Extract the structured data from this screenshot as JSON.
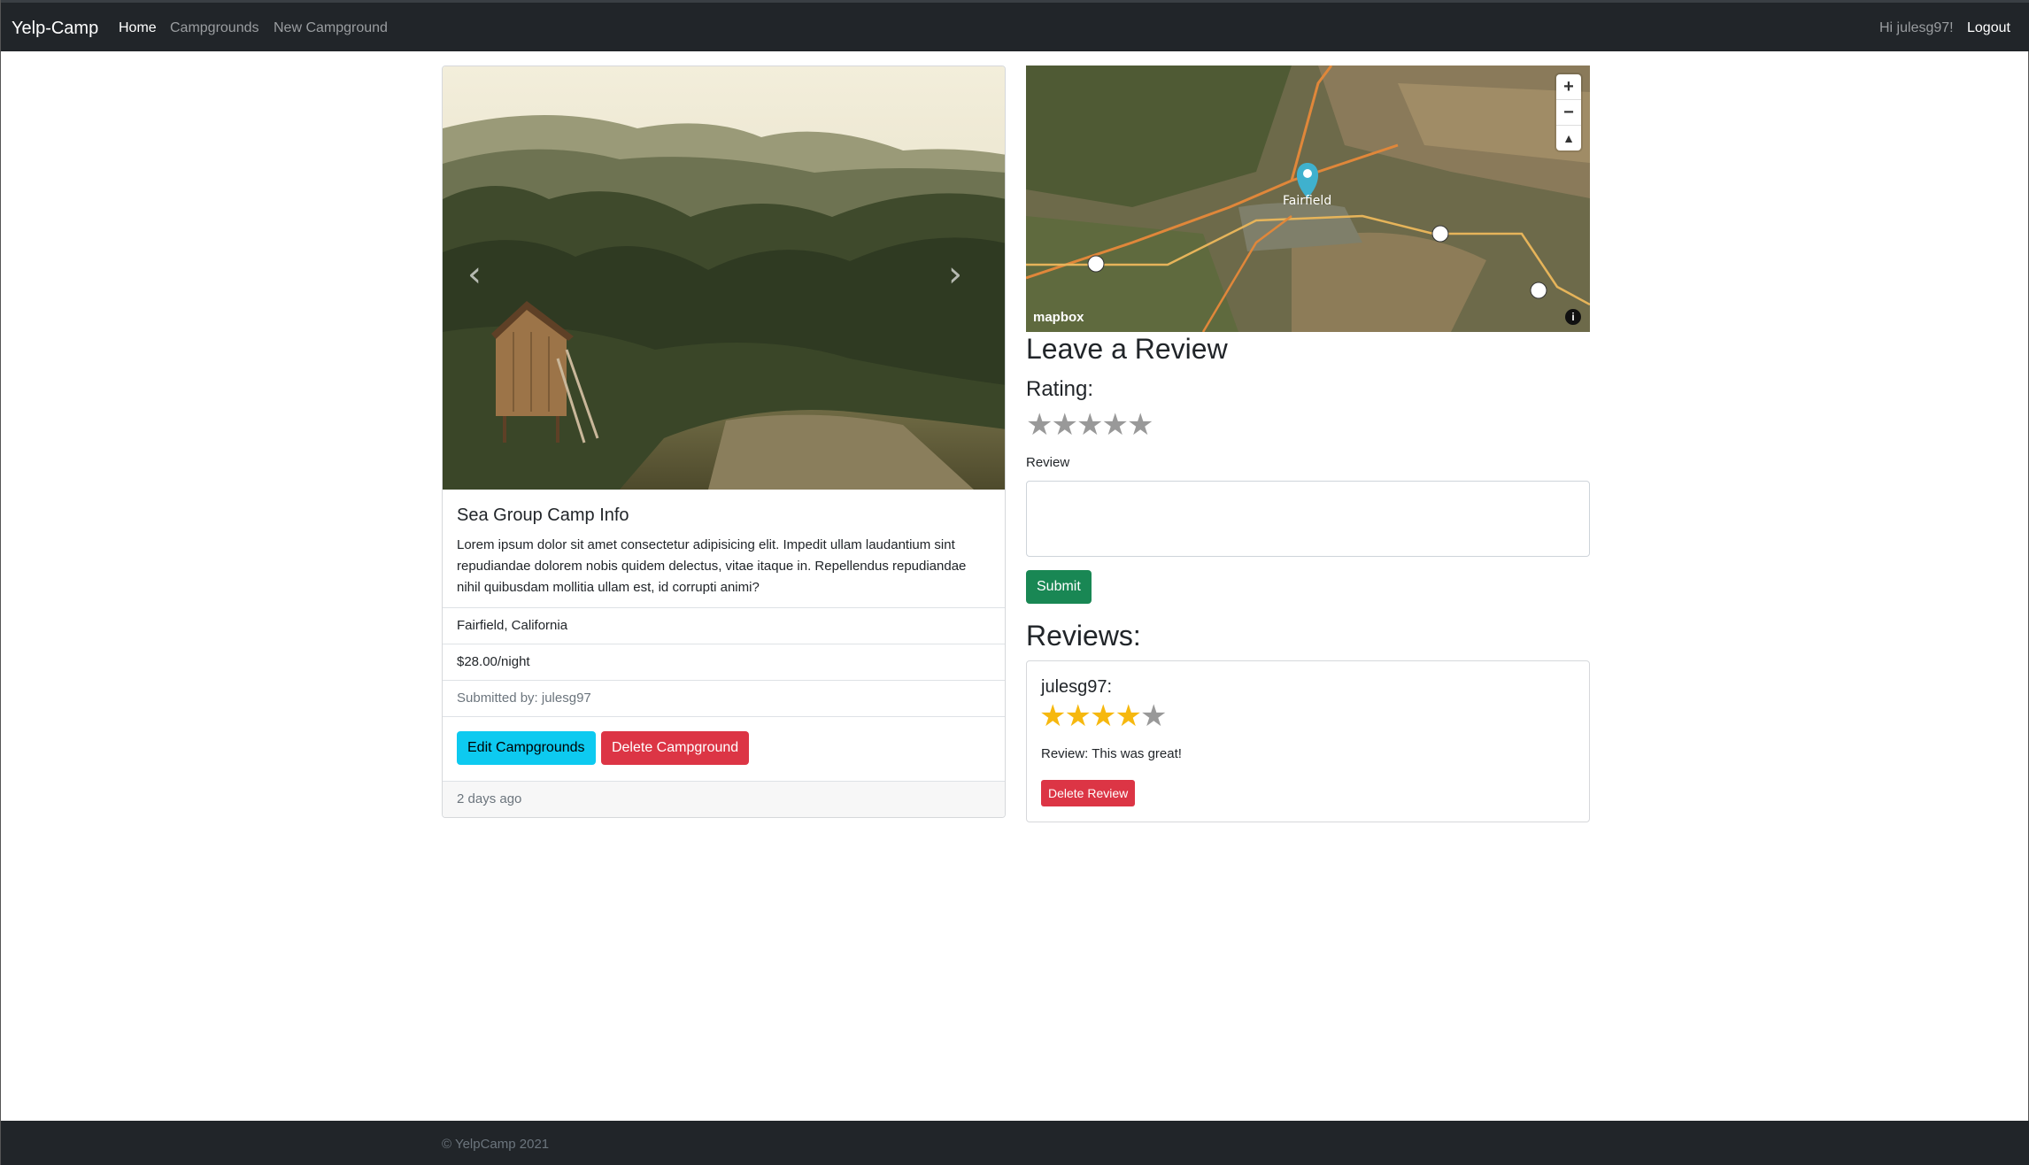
{
  "navbar": {
    "brand": "Yelp-Camp",
    "links": [
      "Home",
      "Campgrounds",
      "New Campground"
    ],
    "greeting": "Hi julesg97!",
    "logout": "Logout"
  },
  "campground": {
    "title": "Sea Group Camp Info",
    "description": "Lorem ipsum dolor sit amet consectetur adipisicing elit. Impedit ullam laudantium sint repudiandae dolorem nobis quidem delectus, vitae itaque in. Repellendus repudiandae nihil quibusdam mollitia ullam est, id corrupti animi?",
    "location": "Fairfield, California",
    "price": "$28.00/night",
    "submitted_by": "Submitted by: julesg97",
    "edit_label": "Edit Campgrounds",
    "delete_label": "Delete Campground",
    "time_ago": "2 days ago"
  },
  "map": {
    "place_label": "Fairfield",
    "logo": "mapbox",
    "zoom_in": "+",
    "zoom_out": "−",
    "compass": "▲",
    "info": "i"
  },
  "review_form": {
    "heading": "Leave a Review",
    "rating_label": "Rating:",
    "rating_value": 0,
    "review_label": "Review",
    "submit_label": "Submit"
  },
  "reviews": {
    "heading": "Reviews:",
    "items": [
      {
        "author": "julesg97:",
        "rating": 4,
        "text": "Review: This was great!",
        "delete_label": "Delete Review"
      }
    ]
  },
  "footer": {
    "text": "© YelpCamp 2021"
  },
  "colors": {
    "navbar_bg": "#212529",
    "star_filled": "#f6b80f",
    "star_empty": "#999999",
    "btn_info": "#0dcaf0",
    "btn_danger": "#dc3545",
    "btn_success": "#198754"
  }
}
